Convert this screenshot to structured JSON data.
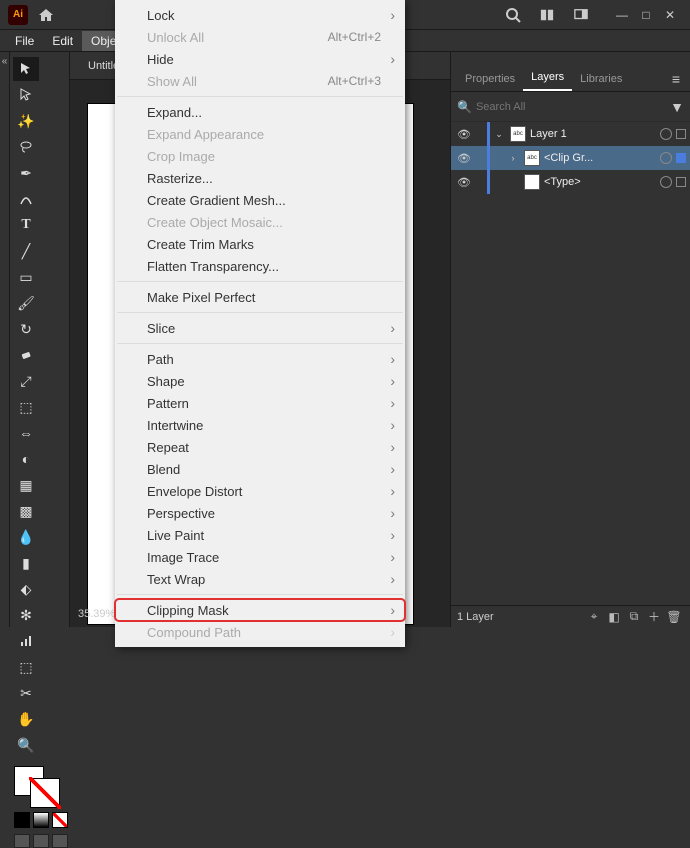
{
  "topbar": {
    "logo_text": "Ai"
  },
  "menubar": {
    "items": [
      "File",
      "Edit",
      "Object"
    ],
    "active_index": 2
  },
  "document": {
    "tab_title": "Untitle",
    "zoom": "35.39%"
  },
  "panels": {
    "tabs": [
      "Properties",
      "Layers",
      "Libraries"
    ],
    "active_tab": 1,
    "search_placeholder": "Search All"
  },
  "layers": {
    "rows": [
      {
        "name": "Layer 1",
        "indent": 0,
        "expanded": true,
        "selected": false,
        "thumb": "text"
      },
      {
        "name": "<Clip Gr...",
        "indent": 1,
        "expanded": false,
        "selected": true,
        "thumb": "text"
      },
      {
        "name": "<Type>",
        "indent": 1,
        "expanded": false,
        "selected": false,
        "thumb": "blank"
      }
    ],
    "footer_count": "1 Layer"
  },
  "context_menu": {
    "groups": [
      [
        {
          "label": "Lock",
          "submenu": true
        },
        {
          "label": "Unlock All",
          "shortcut": "Alt+Ctrl+2",
          "disabled": true
        },
        {
          "label": "Hide",
          "submenu": true
        },
        {
          "label": "Show All",
          "shortcut": "Alt+Ctrl+3",
          "disabled": true
        }
      ],
      [
        {
          "label": "Expand..."
        },
        {
          "label": "Expand Appearance",
          "disabled": true
        },
        {
          "label": "Crop Image",
          "disabled": true
        },
        {
          "label": "Rasterize..."
        },
        {
          "label": "Create Gradient Mesh..."
        },
        {
          "label": "Create Object Mosaic...",
          "disabled": true
        },
        {
          "label": "Create Trim Marks"
        },
        {
          "label": "Flatten Transparency..."
        }
      ],
      [
        {
          "label": "Make Pixel Perfect"
        }
      ],
      [
        {
          "label": "Slice",
          "submenu": true
        }
      ],
      [
        {
          "label": "Path",
          "submenu": true
        },
        {
          "label": "Shape",
          "submenu": true
        },
        {
          "label": "Pattern",
          "submenu": true
        },
        {
          "label": "Intertwine",
          "submenu": true
        },
        {
          "label": "Repeat",
          "submenu": true
        },
        {
          "label": "Blend",
          "submenu": true
        },
        {
          "label": "Envelope Distort",
          "submenu": true
        },
        {
          "label": "Perspective",
          "submenu": true
        },
        {
          "label": "Live Paint",
          "submenu": true
        },
        {
          "label": "Image Trace",
          "submenu": true
        },
        {
          "label": "Text Wrap",
          "submenu": true
        }
      ],
      [
        {
          "label": "Clipping Mask",
          "submenu": true,
          "highlight": true
        },
        {
          "label": "Compound Path",
          "submenu": true,
          "disabled": true
        }
      ]
    ]
  }
}
